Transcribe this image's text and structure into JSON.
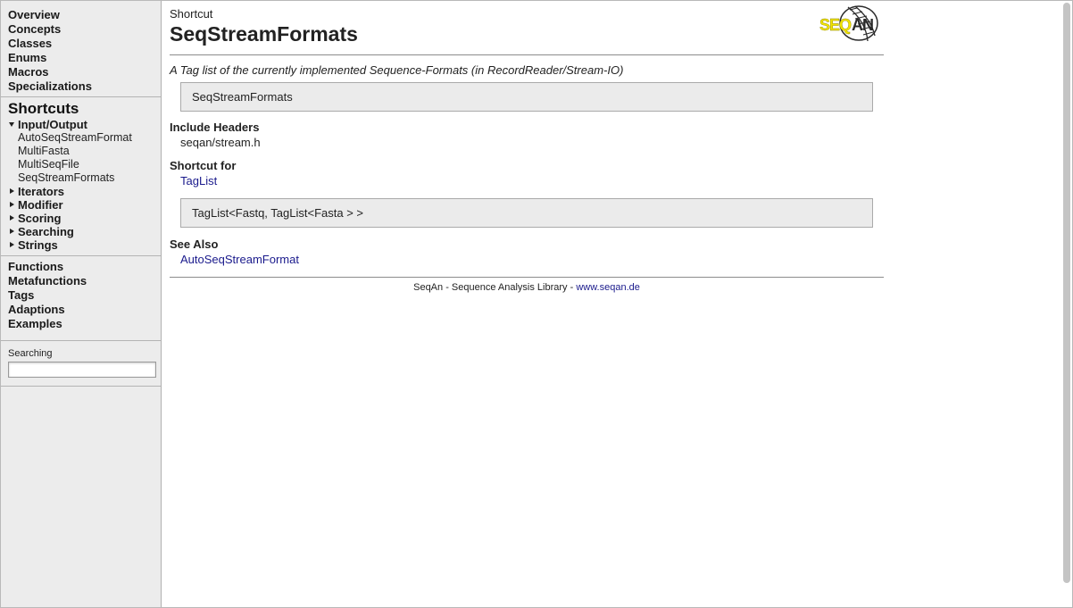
{
  "sidebar": {
    "top_links": [
      "Overview",
      "Concepts",
      "Classes",
      "Enums",
      "Macros",
      "Specializations"
    ],
    "shortcuts_heading": "Shortcuts",
    "categories": [
      {
        "label": "Input/Output",
        "expanded": true,
        "items": [
          "AutoSeqStreamFormat",
          "MultiFasta",
          "MultiSeqFile",
          "SeqStreamFormats"
        ]
      },
      {
        "label": "Iterators",
        "expanded": false
      },
      {
        "label": "Modifier",
        "expanded": false
      },
      {
        "label": "Scoring",
        "expanded": false
      },
      {
        "label": "Searching",
        "expanded": false
      },
      {
        "label": "Strings",
        "expanded": false
      }
    ],
    "bottom_links": [
      "Functions",
      "Metafunctions",
      "Tags",
      "Adaptions",
      "Examples"
    ],
    "search": {
      "label": "Searching",
      "value": ""
    }
  },
  "main": {
    "kind": "Shortcut",
    "title": "SeqStreamFormats",
    "description": "A Tag list of the currently implemented Sequence-Formats (in RecordReader/Stream-IO)",
    "signature": "SeqStreamFormats",
    "include_heading": "Include Headers",
    "include_value": "seqan/stream.h",
    "shortcut_for_heading": "Shortcut for",
    "shortcut_for_link": "TagList",
    "shortcut_for_code": "TagList<Fastq, TagList<Fasta > >",
    "see_also_heading": "See Also",
    "see_also_link": "AutoSeqStreamFormat",
    "footer_text": "SeqAn - Sequence Analysis Library - ",
    "footer_link": "www.seqan.de"
  },
  "logo": {
    "text": "SEQAN",
    "colors": {
      "yellow": "#f2e400",
      "dark": "#2a2a2a"
    }
  },
  "colors": {
    "link": "#1a1a8c",
    "sidebar_bg": "#ececec",
    "codebox_bg": "#ebebeb"
  }
}
